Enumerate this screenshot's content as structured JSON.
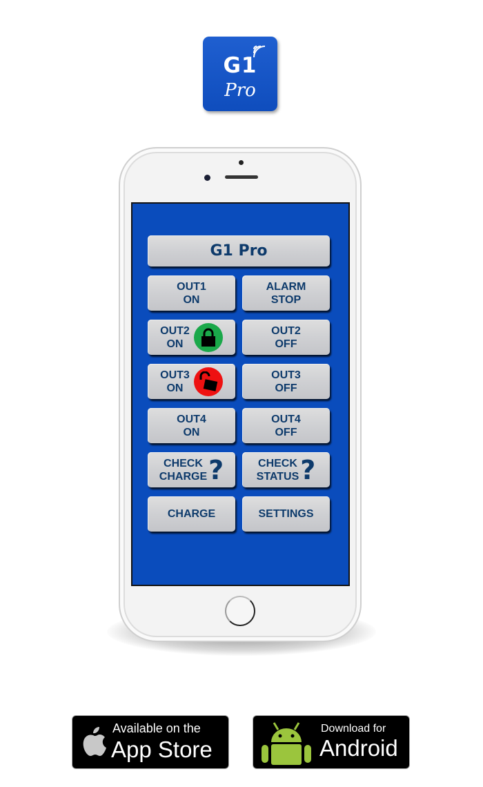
{
  "app_icon": {
    "title": "G1",
    "subtitle": "Pro",
    "icon": "wifi-signal-icon",
    "color": "#1257c8"
  },
  "screen": {
    "background": "#0a4cbc",
    "header_button": "G1 Pro",
    "buttons": [
      {
        "line1": "OUT1",
        "line2": "ON"
      },
      {
        "line1": "ALARM",
        "line2": "STOP"
      },
      {
        "line1": "OUT2",
        "line2": "ON",
        "icon": "lock-closed-icon",
        "icon_color": "#1aa84a"
      },
      {
        "line1": "OUT2",
        "line2": "OFF"
      },
      {
        "line1": "OUT3",
        "line2": "ON",
        "icon": "lock-open-icon",
        "icon_color": "#ee1111"
      },
      {
        "line1": "OUT3",
        "line2": "OFF"
      },
      {
        "line1": "OUT4",
        "line2": "ON"
      },
      {
        "line1": "OUT4",
        "line2": "OFF"
      },
      {
        "line1": "CHECK",
        "line2": "CHARGE",
        "icon": "question-mark-icon",
        "glyph": "?"
      },
      {
        "line1": "CHECK",
        "line2": "STATUS",
        "icon": "question-mark-icon",
        "glyph": "?"
      },
      {
        "line1": "CHARGE"
      },
      {
        "line1": "SETTINGS"
      }
    ]
  },
  "badges": {
    "apple": {
      "small": "Available on the",
      "big": "App Store"
    },
    "android": {
      "small": "Download for",
      "big": "Android",
      "color": "#9bc53d"
    }
  }
}
